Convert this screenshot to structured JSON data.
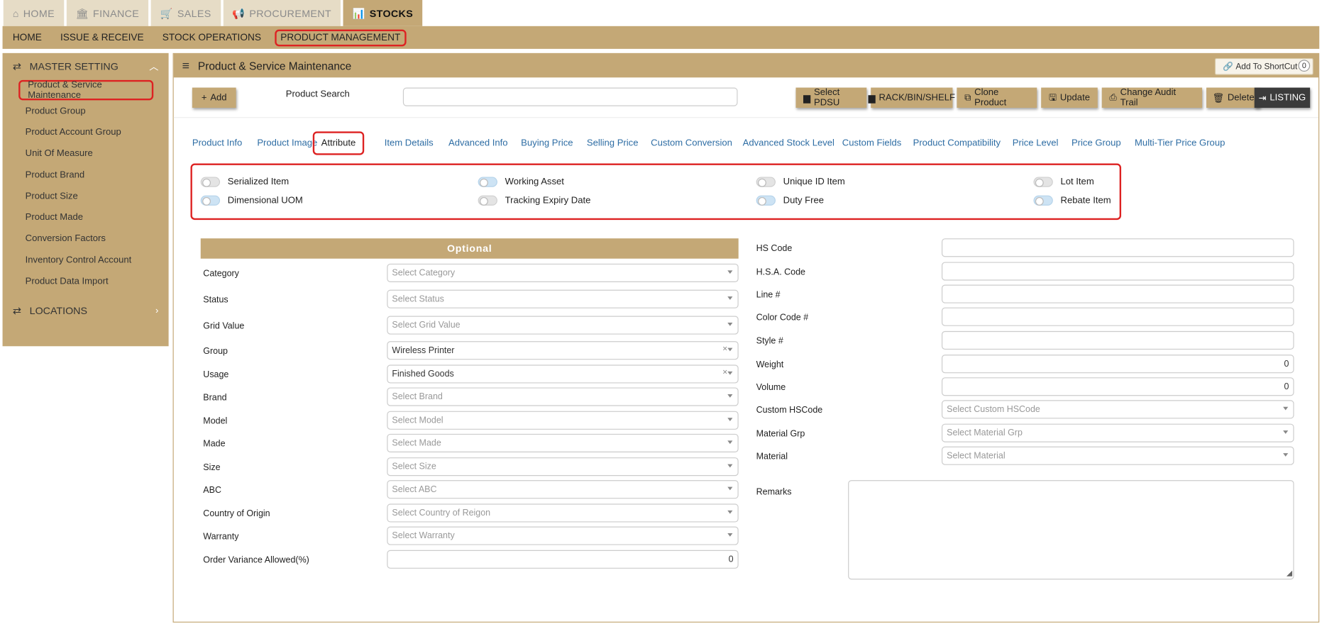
{
  "top_tabs": [
    {
      "label": "HOME",
      "icon": "home-icon",
      "glyph": "⌂"
    },
    {
      "label": "FINANCE",
      "icon": "bank-icon",
      "glyph": "🏛"
    },
    {
      "label": "SALES",
      "icon": "cart-icon",
      "glyph": "🛒"
    },
    {
      "label": "PROCUREMENT",
      "icon": "bullhorn-icon",
      "glyph": "📢"
    },
    {
      "label": "STOCKS",
      "icon": "chart-icon",
      "glyph": "📊"
    }
  ],
  "menu": [
    "HOME",
    "ISSUE & RECEIVE",
    "STOCK OPERATIONS",
    "PRODUCT MANAGEMENT"
  ],
  "sidebar": {
    "master_label": "MASTER SETTING",
    "items": [
      "Product & Service Maintenance",
      "Product Group",
      "Product Account Group",
      "Unit Of Measure",
      "Product Brand",
      "Product Size",
      "Product Made",
      "Conversion Factors",
      "Inventory Control Account",
      "Product Data Import"
    ],
    "locations_label": "LOCATIONS"
  },
  "main": {
    "title": "Product & Service Maintenance",
    "shortcut_label": "Add To ShortCut",
    "shortcut_count": "0"
  },
  "toolbar": {
    "add": "Add",
    "search_label": "Product Search",
    "search_value": "",
    "buttons": [
      "Select PDSU",
      "RACK/BIN/SHELF",
      "Clone Product",
      "Update",
      "Change Audit Trail",
      "Delete",
      "LISTING"
    ]
  },
  "tabs": [
    "Product Info",
    "Product Image",
    "Attribute",
    "Item Details",
    "Advanced Info",
    "Buying Price",
    "Selling Price",
    "Custom Conversion",
    "Advanced Stock Level",
    "Custom Fields",
    "Product Compatibility",
    "Price Level",
    "Price Group",
    "Multi-Tier Price Group"
  ],
  "toggles": [
    {
      "label": "Serialized Item"
    },
    {
      "label": "Working Asset"
    },
    {
      "label": "Unique ID Item"
    },
    {
      "label": "Lot Item"
    },
    {
      "label": "Dimensional UOM"
    },
    {
      "label": "Tracking Expiry Date"
    },
    {
      "label": "Duty Free"
    },
    {
      "label": "Rebate Item"
    }
  ],
  "optional": {
    "header": "Optional",
    "fields": [
      {
        "label": "Category",
        "value": "Select Category"
      },
      {
        "label": "Status",
        "value": "Select Status"
      },
      {
        "label": "Grid Value",
        "value": "Select Grid Value"
      },
      {
        "label": "Group",
        "value": "Wireless Printer"
      },
      {
        "label": "Usage",
        "value": "Finished Goods"
      },
      {
        "label": "Brand",
        "value": "Select Brand"
      },
      {
        "label": "Model",
        "value": "Select Model"
      },
      {
        "label": "Made",
        "value": "Select Made"
      },
      {
        "label": "Size",
        "value": "Select Size"
      },
      {
        "label": "ABC",
        "value": "Select ABC"
      },
      {
        "label": "Country of Origin",
        "value": "Select Country of Reigon"
      },
      {
        "label": "Warranty",
        "value": "Select Warranty"
      },
      {
        "label": "Order Variance Allowed(%)",
        "value": "0"
      }
    ]
  },
  "right_fields": [
    {
      "label": "HS Code",
      "value": ""
    },
    {
      "label": "H.S.A. Code",
      "value": ""
    },
    {
      "label": "Line #",
      "value": ""
    },
    {
      "label": "Color Code #",
      "value": ""
    },
    {
      "label": "Style #",
      "value": ""
    },
    {
      "label": "Weight",
      "value": "0"
    },
    {
      "label": "Volume",
      "value": "0"
    },
    {
      "label": "Custom HSCode",
      "value": "Select Custom HSCode"
    },
    {
      "label": "Material Grp",
      "value": "Select Material Grp"
    },
    {
      "label": "Material",
      "value": "Select Material"
    }
  ],
  "remarks_label": "Remarks",
  "colors": {
    "accent": "#c4a876",
    "highlight": "#dd2222",
    "link": "#2e6da4",
    "dark_button": "#3b3b3b"
  }
}
